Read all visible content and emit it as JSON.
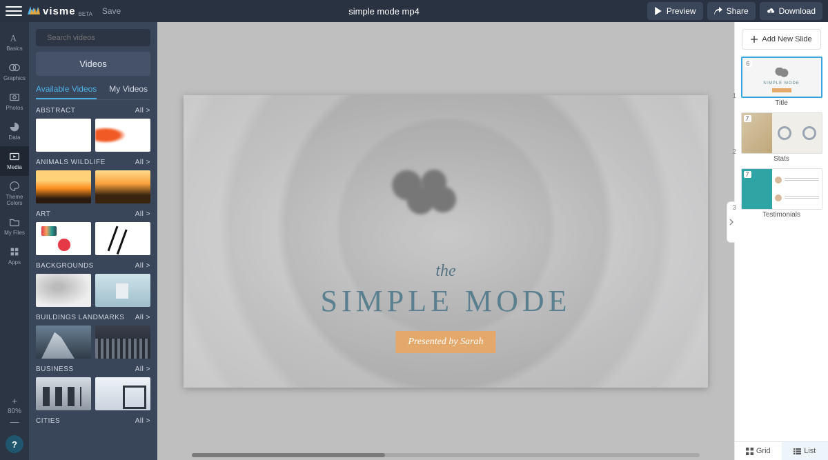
{
  "header": {
    "logo_text": "visme",
    "logo_beta": "BETA",
    "save": "Save",
    "doc_title": "simple mode mp4",
    "preview": "Preview",
    "share": "Share",
    "download": "Download"
  },
  "iconrail": {
    "basics": "Basics",
    "graphics": "Graphics",
    "photos": "Photos",
    "data": "Data",
    "media": "Media",
    "theme_colors": "Theme\nColors",
    "my_files": "My Files",
    "apps": "Apps",
    "zoom": "80%"
  },
  "panel": {
    "search_placeholder": "Search videos",
    "videos_btn": "Videos",
    "tabs": {
      "available": "Available Videos",
      "my": "My Videos"
    },
    "all": "All >",
    "categories": [
      "ABSTRACT",
      "ANIMALS WILDLIFE",
      "ART",
      "BACKGROUNDS",
      "BUILDINGS LANDMARKS",
      "BUSINESS",
      "CITIES"
    ]
  },
  "canvas": {
    "the": "the",
    "title": "SIMPLE MODE",
    "presenter": "Presented by Sarah"
  },
  "right": {
    "add_slide": "Add New Slide",
    "slides": [
      {
        "num": "1",
        "badge": "6",
        "caption": "Title"
      },
      {
        "num": "2",
        "badge": "7",
        "caption": "Stats"
      },
      {
        "num": "3",
        "badge": "7",
        "caption": "Testimonials"
      }
    ],
    "grid": "Grid",
    "list": "List"
  }
}
